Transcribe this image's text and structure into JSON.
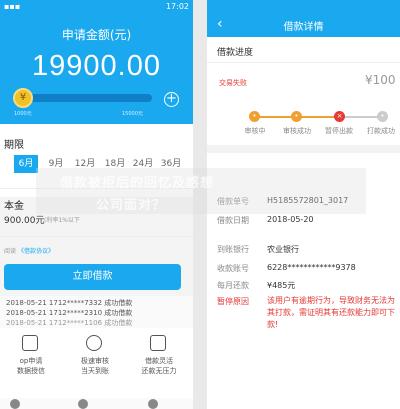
{
  "left": {
    "status_left": "▪▪▪",
    "status_right": "17:02",
    "title": "申请金额(元)",
    "amount": "19900.00",
    "slider_min": "1000元",
    "slider_max": "15000元",
    "slider_fraction": 0.1,
    "term_label": "期限",
    "terms": [
      "6月",
      "9月",
      "12月",
      "18月",
      "24月",
      "36月"
    ],
    "principal_label": "本金",
    "principal_value": "900.00元",
    "principal_note": "(利率1%以下",
    "agreement_prefix": "阅读",
    "agreement_link": "《借款协议》",
    "apply_button": "立即借款",
    "ticker": [
      "2018-05-21   1712*****7332  成功借款",
      "2018-05-21   1712*****2310  成功借款",
      "2018-05-21   1712*****1106  成功借款"
    ],
    "features": [
      {
        "line1": "op申请",
        "line2": "数据授信",
        "icon": "phone-icon"
      },
      {
        "line1": "极速审核",
        "line2": "当天到账",
        "icon": "search-icon"
      },
      {
        "line1": "借款灵活",
        "line2": "还款无压力",
        "icon": "thumbs-up-icon"
      }
    ]
  },
  "right": {
    "back_icon": "‹",
    "title": "借款详情",
    "progress_label": "借款进度",
    "fail_text": "交易失败",
    "amount": "¥100",
    "steps": [
      "审核中",
      "审核成功",
      "暂停出款",
      "打款成功"
    ],
    "rows": [
      {
        "label": "借款单号",
        "value": "H5185572801_3017"
      },
      {
        "label": "借款日期",
        "value": "2018-05-20"
      },
      {
        "label": "到账银行",
        "value": "农业银行"
      },
      {
        "label": "收款账号",
        "value": "6228************9378"
      },
      {
        "label": "每月还款",
        "value": "¥485元"
      }
    ],
    "pause_label": "暂停原因",
    "pause_reason": "该用户有逾期行为，导致财务无法为其打款，需证明其有还款能力即可下款!"
  },
  "overlay": {
    "line1": "借款被拒后的回忆及感想",
    "line2": "公司面对？"
  }
}
